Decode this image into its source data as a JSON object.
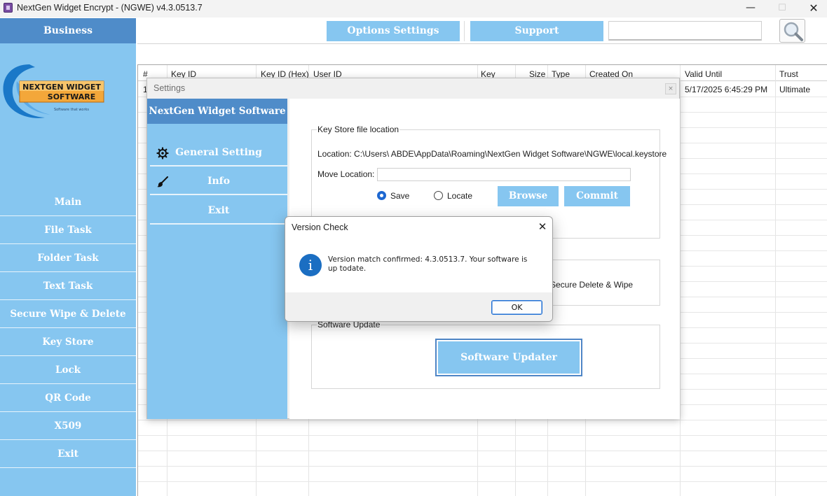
{
  "window": {
    "title": "NextGen Widget Encrypt - (NGWE) v4.3.0513.7",
    "minimize": "—",
    "maximize": "☐",
    "close": "✕"
  },
  "sidebar": {
    "header": "Business",
    "logo": {
      "line1": "NEXTGEN WIDGET",
      "line2": "SOFTWARE",
      "tagline": "Software that works"
    },
    "items": [
      {
        "label": "Main"
      },
      {
        "label": "File Task"
      },
      {
        "label": "Folder Task"
      },
      {
        "label": "Text Task"
      },
      {
        "label": "Secure Wipe & Delete"
      },
      {
        "label": "Key Store"
      },
      {
        "label": "Lock"
      },
      {
        "label": "QR Code"
      },
      {
        "label": "X509"
      },
      {
        "label": "Exit"
      }
    ]
  },
  "topbar": {
    "options_label": "Options Settings",
    "support_label": "Support",
    "search_value": "",
    "search_icon": "magnifier-icon"
  },
  "grid": {
    "columns": [
      "#",
      "Key ID",
      "Key ID (Hex)",
      "User ID",
      "Key",
      "Size",
      "Type",
      "Created On",
      "Valid Until",
      "Trust"
    ],
    "row1": {
      "index": "1",
      "valid_until": "5/17/2025 6:45:29 PM",
      "trust": "Ultimate"
    }
  },
  "settings": {
    "title": "Settings",
    "close": "×",
    "nav_header": "NextGen Widget Software",
    "nav": [
      {
        "label": "General Setting",
        "icon": "gear-icon"
      },
      {
        "label": "Info",
        "icon": "brush-icon"
      },
      {
        "label": "Exit"
      }
    ],
    "keystore": {
      "group_title": "Key Store file location",
      "location_text": "Location: C:\\Users\\ ABDE\\AppData\\Roaming\\NextGen Widget Software\\NGWE\\local.keystore",
      "move_label": "Move Location:",
      "move_value": "",
      "radio_save": "Save",
      "radio_locate": "Locate",
      "browse": "Browse",
      "commit": "Commit"
    },
    "wipe": {
      "text": "Secure Delete & Wipe"
    },
    "update": {
      "group_title": "Software Update",
      "button": "Software Updater"
    }
  },
  "dialog": {
    "title": "Version Check",
    "close": "✕",
    "icon": "i",
    "message": "Version match confirmed: 4.3.0513.7. Your software is up todate.",
    "ok": "OK"
  }
}
